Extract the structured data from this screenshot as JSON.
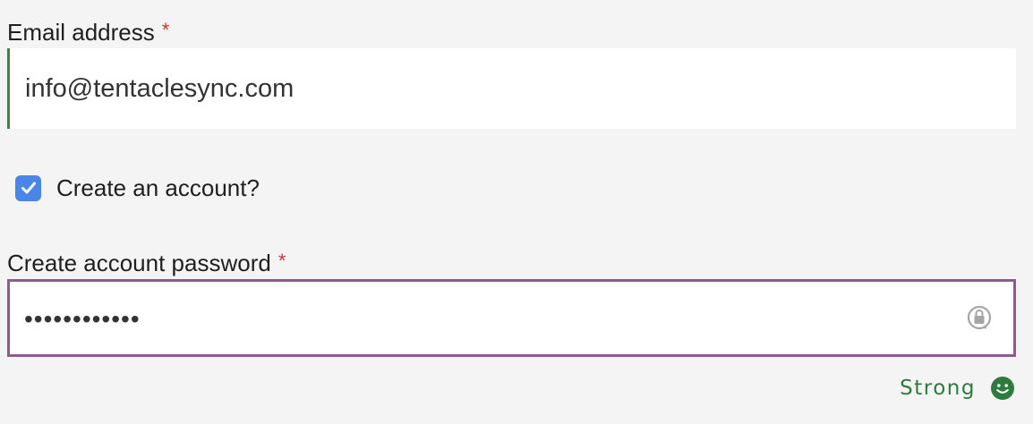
{
  "email": {
    "label": "Email address",
    "required_mark": "*",
    "value": "info@tentaclesync.com"
  },
  "create_account": {
    "label": "Create an account?",
    "checked": true
  },
  "password": {
    "label": "Create account password",
    "required_mark": "*",
    "value": "••••••••••••",
    "icon": "password-manager-lock-icon"
  },
  "strength": {
    "text": "Strong",
    "icon": "smiley-face-icon",
    "color": "#2f7a3f"
  },
  "colors": {
    "background": "#f4f4f4",
    "email_accent": "#3f7f4a",
    "password_border": "#8a5d8c",
    "checkbox": "#4a86e8",
    "required": "#c0392b"
  }
}
